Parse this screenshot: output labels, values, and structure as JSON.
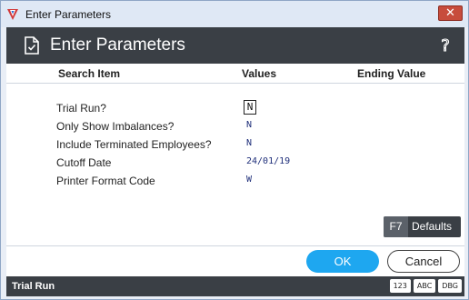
{
  "window": {
    "title": "Enter Parameters",
    "close_glyph": "✕"
  },
  "header": {
    "title": "Enter Parameters",
    "help_glyph": "?"
  },
  "columns": {
    "search_item": "Search Item",
    "values": "Values",
    "ending_value": "Ending Value"
  },
  "params": [
    {
      "label": "Trial Run?",
      "value": "N"
    },
    {
      "label": "Only Show Imbalances?",
      "value": "N"
    },
    {
      "label": "Include Terminated Employees?",
      "value": "N"
    },
    {
      "label": "Cutoff Date",
      "value": "24/01/19"
    },
    {
      "label": "Printer Format Code",
      "value": "W"
    }
  ],
  "defaults_button": {
    "key": "F7",
    "label": "Defaults"
  },
  "footer": {
    "ok_label": "OK",
    "cancel_label": "Cancel"
  },
  "status": {
    "text": "Trial Run",
    "badges": [
      "123",
      "ABC",
      "DBG"
    ]
  },
  "colors": {
    "header_bg": "#3a3f45",
    "accent": "#1ea7f0",
    "value_text": "#1f2f7a",
    "close_red": "#c74c3c"
  },
  "icons": {
    "app": "app-logo-icon",
    "document": "document-check-icon",
    "help": "help-question-icon"
  }
}
